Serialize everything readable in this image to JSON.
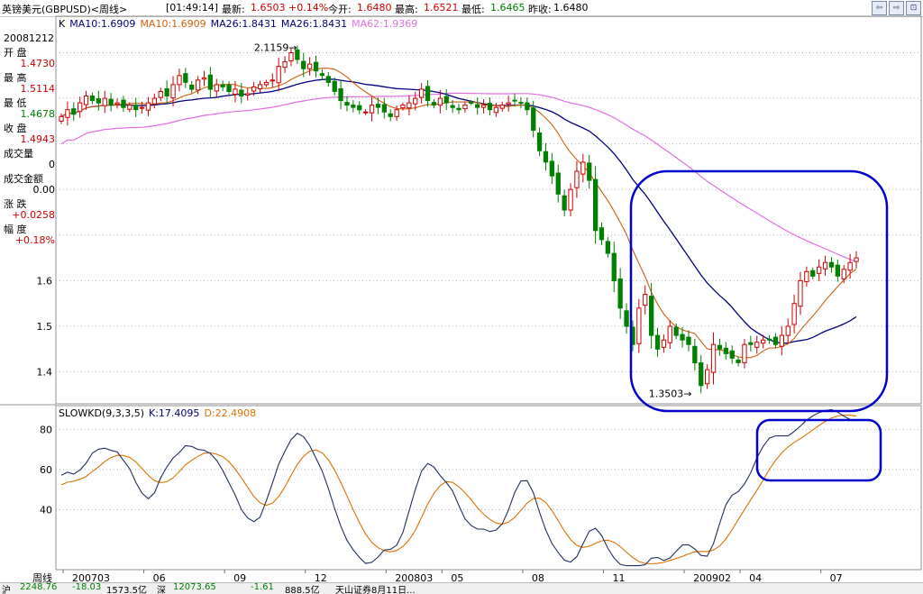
{
  "header": {
    "title": "英镑美元(GBPUSD)<周线>",
    "time": "[01:49:14]",
    "latest_label": "最新:",
    "latest_value": "1.6503",
    "change": "+0.14%",
    "open_label": "今开:",
    "open_value": "1.6480",
    "high_label": "最高:",
    "high_value": "1.6521",
    "low_label": "最低:",
    "low_value": "1.6465",
    "prevclose_label": "昨收:",
    "prevclose_value": "1.6480"
  },
  "left_panel": {
    "date": "20081212",
    "rows": [
      {
        "label": "开  盘",
        "value": "1.4730",
        "color": "#d00000"
      },
      {
        "label": "最  高",
        "value": "1.5114",
        "color": "#d00000"
      },
      {
        "label": "最  低",
        "value": "1.4678",
        "color": "#008000"
      },
      {
        "label": "收  盘",
        "value": "1.4943",
        "color": "#d00000"
      },
      {
        "label": "成交量",
        "value": "0",
        "color": "#000000"
      },
      {
        "label": "成交金额",
        "value": "0.00",
        "color": "#000000"
      },
      {
        "label": "涨  跌",
        "value": "+0.0258",
        "color": "#d00000"
      },
      {
        "label": "幅  度",
        "value": "+0.18%",
        "color": "#d00000"
      }
    ]
  },
  "ma_legend": {
    "prefix": "K",
    "items": [
      {
        "text": "MA10:1.6909",
        "color": "#000080"
      },
      {
        "text": "MA10:1.6909",
        "color": "#d06010"
      },
      {
        "text": "MA26:1.8431",
        "color": "#000080"
      },
      {
        "text": "MA26:1.8431",
        "color": "#000080"
      },
      {
        "text": "MA62:1.9369",
        "color": "#e070e0"
      }
    ]
  },
  "kd_legend": {
    "name": "SLOWKD(9,3,3,5)",
    "k": "K:17.4095",
    "d": "D:22.4908",
    "k_color": "#000080",
    "d_color": "#e07000"
  },
  "annotations": {
    "high_label": "2.1159",
    "low_label": "1.3503"
  },
  "nav_buttons": [
    "⇦",
    "⇨",
    "⊡"
  ],
  "status_bar": [
    "沪",
    "2248.76",
    "-18.03",
    "1573.5亿",
    "深",
    "12073.65",
    "-1.61",
    "888.5亿",
    "天山证券8月11日..."
  ],
  "colors": {
    "up": "#d00000",
    "down": "#008000",
    "ma10": "#d06010",
    "ma26": "#000080",
    "ma62": "#e070e0",
    "k_line": "#203060",
    "d_line": "#e07000",
    "highlight": "#0000c8",
    "grid": "#b0b0b0"
  },
  "chart_data": [
    {
      "type": "candlestick",
      "ylim": [
        1.33,
        2.18
      ],
      "y_ticks": [
        1.4,
        1.5,
        1.6
      ],
      "x_tick_labels": [
        "周线",
        "200703",
        "06",
        "09",
        "12",
        "200803",
        "05",
        "08",
        "11",
        "200902",
        "04",
        "07"
      ],
      "x_tick_index": [
        0,
        0,
        13,
        26,
        39,
        52,
        61,
        74,
        87,
        100,
        109,
        122
      ],
      "close": [
        1.96,
        1.975,
        1.965,
        1.99,
        2.005,
        1.995,
        1.99,
        2.0,
        1.985,
        1.99,
        1.98,
        1.985,
        1.975,
        1.98,
        1.99,
        2.0,
        2.015,
        2.005,
        2.03,
        2.05,
        2.035,
        2.02,
        2.04,
        2.045,
        2.02,
        2.03,
        2.025,
        2.015,
        2.02,
        2.005,
        2.01,
        2.025,
        2.03,
        2.035,
        2.04,
        2.07,
        2.08,
        2.1,
        2.085,
        2.065,
        2.075,
        2.06,
        2.05,
        2.035,
        2.015,
        1.995,
        1.985,
        1.98,
        1.975,
        1.97,
        1.985,
        1.98,
        1.97,
        1.96,
        1.975,
        1.985,
        1.99,
        2.0,
        2.02,
        1.995,
        1.985,
        2.0,
        1.99,
        1.98,
        1.975,
        1.985,
        1.99,
        1.98,
        1.985,
        1.975,
        1.98,
        1.985,
        1.99,
        1.995,
        1.99,
        1.975,
        1.93,
        1.885,
        1.86,
        1.83,
        1.79,
        1.755,
        1.8,
        1.84,
        1.86,
        1.82,
        1.71,
        1.69,
        1.66,
        1.6,
        1.54,
        1.5,
        1.46,
        1.54,
        1.57,
        1.48,
        1.45,
        1.47,
        1.5,
        1.48,
        1.47,
        1.46,
        1.42,
        1.37,
        1.405,
        1.46,
        1.45,
        1.44,
        1.43,
        1.42,
        1.46,
        1.46,
        1.465,
        1.47,
        1.47,
        1.46,
        1.48,
        1.5,
        1.55,
        1.6,
        1.62,
        1.61,
        1.63,
        1.64,
        1.63,
        1.61,
        1.625,
        1.64,
        1.65
      ],
      "ma_last": {
        "ma10": 1.6909,
        "ma26": 1.8431,
        "ma62": 1.9369
      }
    },
    {
      "type": "line",
      "title": "SLOWKD(9,3,3,5)",
      "ylim": [
        10,
        92
      ],
      "y_ticks": [
        40,
        60,
        80
      ],
      "series": [
        {
          "name": "K",
          "last": 17.4095
        },
        {
          "name": "D",
          "last": 22.4908
        }
      ]
    }
  ]
}
